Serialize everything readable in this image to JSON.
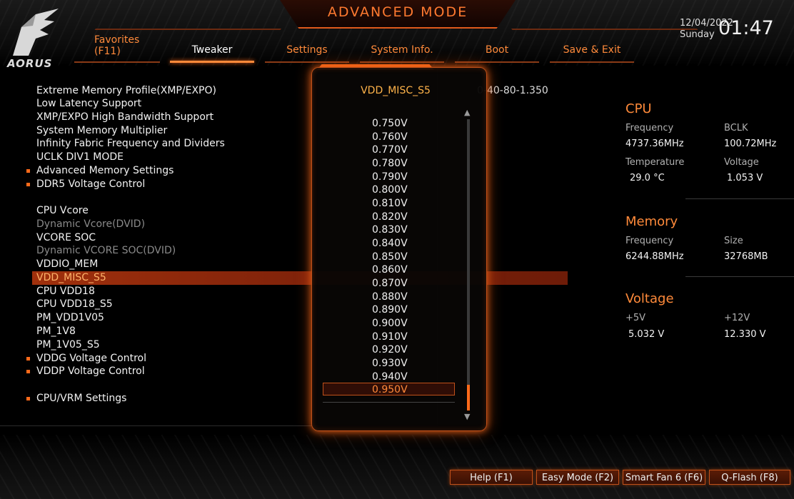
{
  "header": {
    "mode_title": "ADVANCED MODE",
    "logo_text": "AORUS",
    "date": "12/04/2022",
    "day": "Sunday",
    "time": "01:47"
  },
  "tabs": [
    {
      "label": "Favorites\n(F11)",
      "active": false
    },
    {
      "label": "Tweaker",
      "active": true
    },
    {
      "label": "Settings",
      "active": false
    },
    {
      "label": "System Info.",
      "active": false
    },
    {
      "label": "Boot",
      "active": false
    },
    {
      "label": "Save & Exit",
      "active": false
    }
  ],
  "menu": {
    "items": [
      {
        "label": "Extreme Memory Profile(XMP/EXPO)"
      },
      {
        "label": "Low Latency Support"
      },
      {
        "label": "XMP/EXPO High Bandwidth Support"
      },
      {
        "label": "System Memory Multiplier"
      },
      {
        "label": "Infinity Fabric Frequency and Dividers"
      },
      {
        "label": "UCLK DIV1 MODE"
      },
      {
        "label": "Advanced Memory Settings",
        "submenu": true
      },
      {
        "label": "DDR5 Voltage Control",
        "submenu": true
      },
      {
        "label": "CPU Vcore"
      },
      {
        "label": "Dynamic Vcore(DVID)",
        "dim": true
      },
      {
        "label": "VCORE SOC"
      },
      {
        "label": "Dynamic VCORE SOC(DVID)",
        "dim": true
      },
      {
        "label": "VDDIO_MEM"
      },
      {
        "label": "VDD_MISC_S5",
        "selected": true
      },
      {
        "label": "CPU VDD18"
      },
      {
        "label": "CPU VDD18_S5"
      },
      {
        "label": "PM_VDD1V05"
      },
      {
        "label": "PM_1V8"
      },
      {
        "label": "PM_1V05_S5"
      },
      {
        "label": "VDDG Voltage Control",
        "submenu": true
      },
      {
        "label": "VDDP Voltage Control",
        "submenu": true
      },
      {
        "label": "CPU/VRM Settings",
        "submenu": true
      }
    ],
    "top_value_fragment": "0-40-80-1.350"
  },
  "popup": {
    "title": "VDD_MISC_S5",
    "options": [
      "0.750V",
      "0.760V",
      "0.770V",
      "0.780V",
      "0.790V",
      "0.800V",
      "0.810V",
      "0.820V",
      "0.830V",
      "0.840V",
      "0.850V",
      "0.860V",
      "0.870V",
      "0.880V",
      "0.890V",
      "0.900V",
      "0.910V",
      "0.920V",
      "0.930V",
      "0.940V",
      "0.950V"
    ],
    "selected_option": "0.950V",
    "scroll_position": 1.0
  },
  "cpu": {
    "heading": "CPU",
    "freq_label": "Frequency",
    "freq_value": "4737.36MHz",
    "bclk_label": "BCLK",
    "bclk_value": "100.72MHz",
    "temp_label": "Temperature",
    "temp_value": "29.0 °C",
    "volt_label": "Voltage",
    "volt_value": "1.053 V"
  },
  "memory": {
    "heading": "Memory",
    "freq_label": "Frequency",
    "freq_value": "6244.88MHz",
    "size_label": "Size",
    "size_value": "32768MB"
  },
  "voltage": {
    "heading": "Voltage",
    "v5_label": "+5V",
    "v5_value": "5.032 V",
    "v12_label": "+12V",
    "v12_value": "12.330 V"
  },
  "footer": {
    "help": "Help (F1)",
    "easy_mode": "Easy Mode (F2)",
    "smart_fan": "Smart Fan 6 (F6)",
    "qflash": "Q-Flash (F8)"
  },
  "colors": {
    "accent": "#ff8a3a",
    "selection": "#a0300c",
    "popup_border": "#c0501a"
  }
}
